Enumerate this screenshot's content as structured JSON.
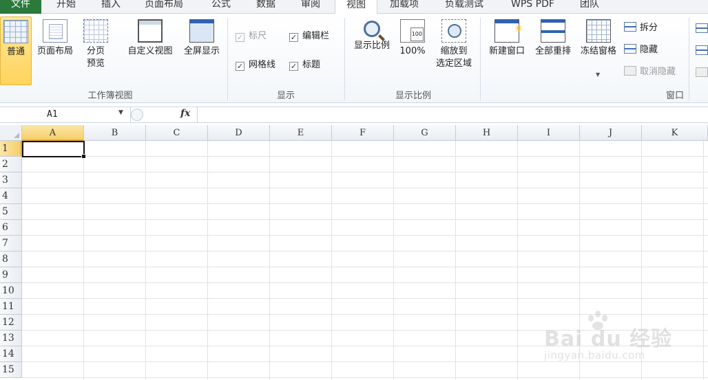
{
  "tabs": [
    {
      "label": "文件"
    },
    {
      "label": "开始"
    },
    {
      "label": "插入"
    },
    {
      "label": "页面布局"
    },
    {
      "label": "公式"
    },
    {
      "label": "数据"
    },
    {
      "label": "审阅"
    },
    {
      "label": "视图"
    },
    {
      "label": "加载项"
    },
    {
      "label": "负载测试"
    },
    {
      "label": "WPS PDF"
    },
    {
      "label": "团队"
    }
  ],
  "active_tab": "视图",
  "ribbon": {
    "workbook_views": {
      "label": "工作簿视图",
      "normal": "普通",
      "page_layout": "页面布局",
      "page_break_line1": "分页",
      "page_break_line2": "预览",
      "custom_views": "自定义视图",
      "full_screen": "全屏显示"
    },
    "show": {
      "label": "显示",
      "ruler": "标尺",
      "formula_bar": "编辑栏",
      "gridlines": "网格线",
      "headings": "标题",
      "check_mark": "✓"
    },
    "zoom": {
      "label": "显示比例",
      "zoom": "显示比例",
      "hundred": "100%",
      "zoom_sel_line1": "缩放到",
      "zoom_sel_line2": "选定区域"
    },
    "window": {
      "label": "窗口",
      "new_window": "新建窗口",
      "arrange_all": "全部重排",
      "freeze_panes": "冻结窗格",
      "caret": "▼",
      "split": "拆分",
      "hide": "隐藏",
      "unhide": "取消隐藏"
    }
  },
  "formula_bar": {
    "name_box": "A1",
    "arrow": "▼",
    "fx": "fx"
  },
  "columns": [
    "A",
    "B",
    "C",
    "D",
    "E",
    "F",
    "G",
    "H",
    "I",
    "J",
    "K"
  ],
  "rows": [
    "1",
    "2",
    "3",
    "4",
    "5",
    "6",
    "7",
    "8",
    "9",
    "10",
    "11",
    "12",
    "13",
    "14",
    "15"
  ],
  "selected_cell": "A1",
  "watermark": {
    "brand": "Bai du 经验",
    "url": "jingyan.baidu.com"
  },
  "colors": {
    "file_tab": "#2a7a3b",
    "selected_header": "#f5cf6a",
    "selected_button": "#ffd35e",
    "gridline": "#dfe3e8"
  }
}
